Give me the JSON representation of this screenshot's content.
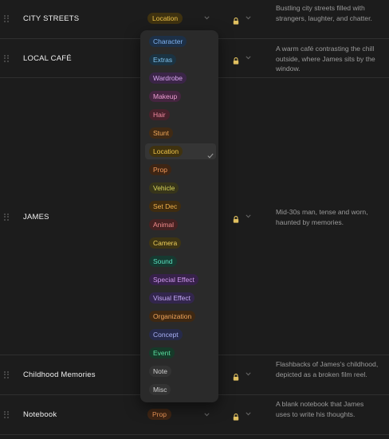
{
  "rows": [
    {
      "name": "CITY STREETS",
      "category": "Location",
      "cat_color": "#f0c54a",
      "cat_bg": "#3f3210",
      "description": "Bustling city streets filled with strangers, laughter, and chatter."
    },
    {
      "name": "LOCAL CAFÉ",
      "category": "",
      "description": "A warm café contrasting the chill outside, where James sits by the window."
    },
    {
      "name": "JAMES",
      "category": "",
      "description": "Mid-30s man, tense and worn, haunted by memories."
    },
    {
      "name": "Childhood Memories",
      "category": "",
      "description": "Flashbacks of James's childhood, depicted as a broken film reel."
    },
    {
      "name": "Notebook",
      "category": "Prop",
      "cat_color": "#f29a5a",
      "cat_bg": "#3e2514",
      "description": "A blank notebook that James uses to write his thoughts."
    }
  ],
  "dropdown": {
    "selected": "Location",
    "options": [
      {
        "label": "Character",
        "color": "#7fb2f0",
        "bg": "#1d3047"
      },
      {
        "label": "Extras",
        "color": "#7fc3f0",
        "bg": "#1b3342"
      },
      {
        "label": "Wardrobe",
        "color": "#d7a6ee",
        "bg": "#3b2548"
      },
      {
        "label": "Makeup",
        "color": "#ee9ed2",
        "bg": "#452540"
      },
      {
        "label": "Hair",
        "color": "#f08aa0",
        "bg": "#47212b"
      },
      {
        "label": "Stunt",
        "color": "#f0a85a",
        "bg": "#402a14"
      },
      {
        "label": "Location",
        "color": "#f0c54a",
        "bg": "#3f3210"
      },
      {
        "label": "Prop",
        "color": "#f29a5a",
        "bg": "#3e2514"
      },
      {
        "label": "Vehicle",
        "color": "#d8d45a",
        "bg": "#37351a"
      },
      {
        "label": "Set Dec",
        "color": "#f0b04a",
        "bg": "#3f2c10"
      },
      {
        "label": "Animal",
        "color": "#f08a8a",
        "bg": "#452121"
      },
      {
        "label": "Camera",
        "color": "#f0d05a",
        "bg": "#3d3414"
      },
      {
        "label": "Sound",
        "color": "#5ae0c0",
        "bg": "#163a31"
      },
      {
        "label": "Special Effect",
        "color": "#d09af0",
        "bg": "#37214a"
      },
      {
        "label": "Visual Effect",
        "color": "#c2a8f4",
        "bg": "#33264d"
      },
      {
        "label": "Organization",
        "color": "#f0a45a",
        "bg": "#3e2812"
      },
      {
        "label": "Concept",
        "color": "#a8b0f4",
        "bg": "#262a4a"
      },
      {
        "label": "Event",
        "color": "#5ae0a0",
        "bg": "#163a29"
      },
      {
        "label": "Note",
        "color": "#cfcfcf",
        "bg": "#333333"
      },
      {
        "label": "Misc",
        "color": "#cfcfcf",
        "bg": "#333333"
      }
    ]
  },
  "icons": {
    "row_handle": "drag-handle-icon",
    "lock": "lock-icon",
    "chevron": "chevron-down-icon",
    "check": "check-icon"
  }
}
